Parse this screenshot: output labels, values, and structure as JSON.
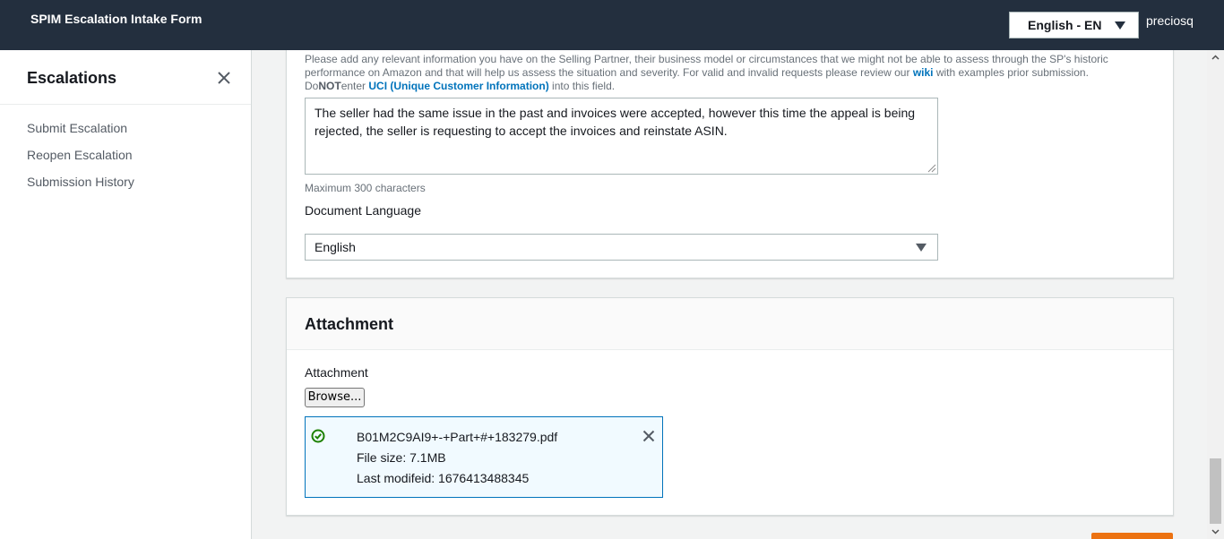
{
  "header": {
    "app_title": "SPIM Escalation Intake Form",
    "language_select": "English - EN",
    "username": "preciosq"
  },
  "sidebar": {
    "title": "Escalations",
    "items": [
      {
        "label": "Submit Escalation"
      },
      {
        "label": "Reopen Escalation"
      },
      {
        "label": "Submission History"
      }
    ]
  },
  "details": {
    "description_part1": "Please add any relevant information you have on the Selling Partner, their business model or circumstances that we might not be able to assess through the SP's historic performance on Amazon and that will help us assess the situation and severity. For valid and invalid requests please review our ",
    "wiki_link": "wiki",
    "description_part2": " with examples prior submission.",
    "do_label": "Do",
    "not_label": "NOT",
    "enter_label": "enter ",
    "uci_link": "UCI (Unique Customer Information)",
    "description_part3": " into this field.",
    "textarea_value": "The seller had the same issue in the past and invoices were accepted, however this time the appeal is being rejected, the seller is requesting to accept the invoices and reinstate ASIN.",
    "max_hint": "Maximum 300 characters",
    "document_language_label": "Document Language",
    "document_language_value": "English"
  },
  "attachment": {
    "section_title": "Attachment",
    "field_label": "Attachment",
    "browse_label": "Browse...",
    "file": {
      "name": "B01M2C9AI9+-+Part+#+183279.pdf",
      "size": "File size: 7.1MB",
      "modified": "Last modifeid: 1676413488345"
    }
  },
  "colors": {
    "topbar": "#232f3e",
    "link": "#0073bb",
    "primary_button": "#ec7211",
    "success": "#1d8102"
  }
}
